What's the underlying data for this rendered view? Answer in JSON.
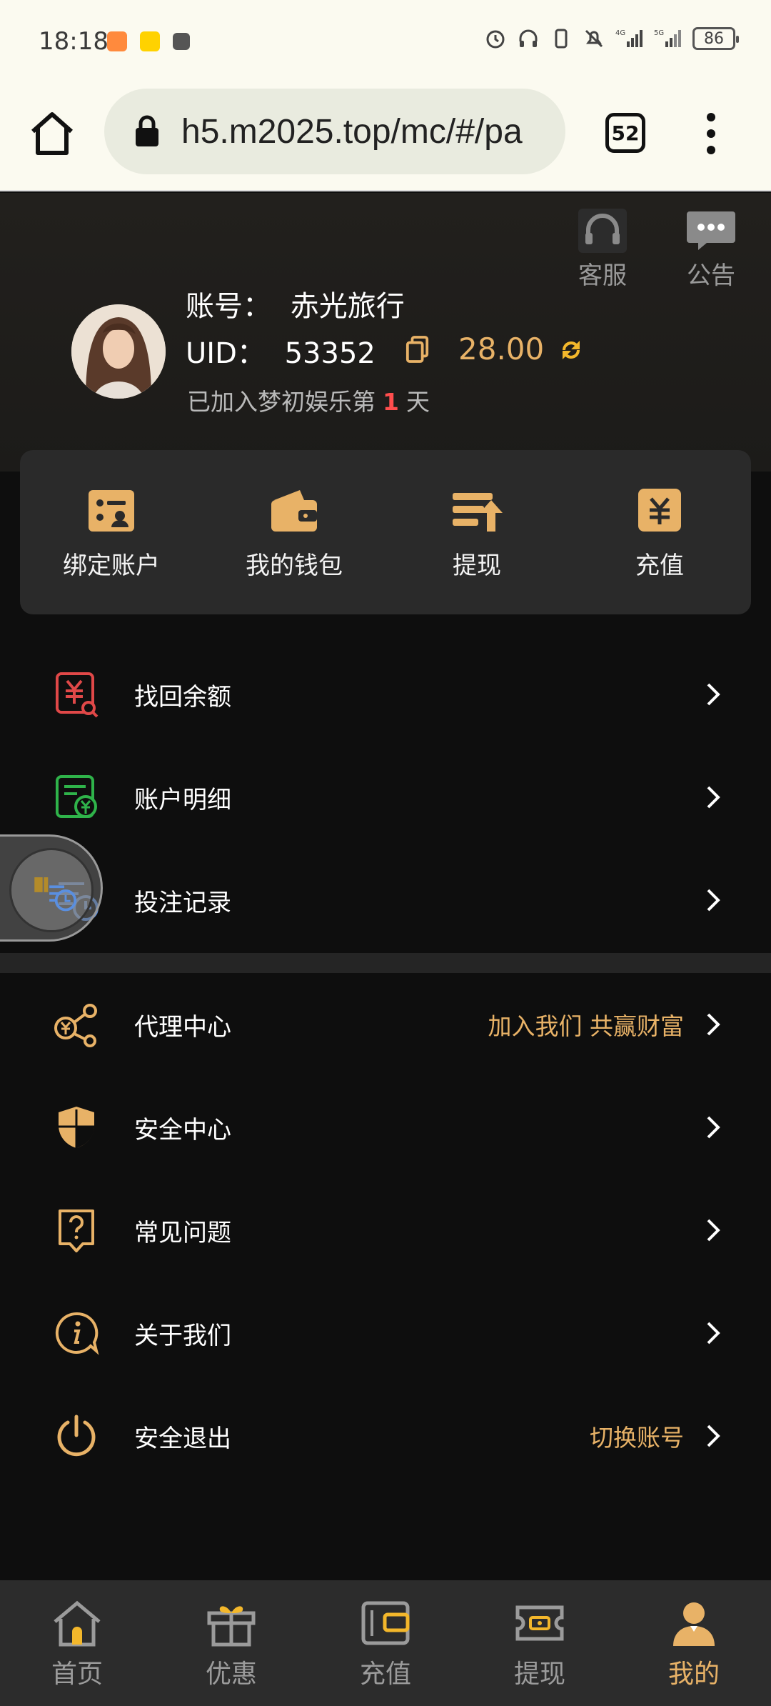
{
  "status_bar": {
    "time": "18:18",
    "battery": "86",
    "icons": [
      "taobao-app-icon",
      "meituan-app-icon",
      "app-icon",
      "alarm-icon",
      "headphones-icon",
      "vibrate-icon",
      "mute-icon",
      "signal-4g-icon",
      "signal-5g-icon",
      "battery-icon"
    ]
  },
  "browser": {
    "url": "h5.m2025.top/mc/#/pa",
    "tab_count": "52"
  },
  "header": {
    "service_label": "客服",
    "notice_label": "公告",
    "account_label": "账号：",
    "account_name": "赤光旅行",
    "uid_label": "UID：",
    "uid": "53352",
    "balance": "28.00",
    "join_prefix": "已加入梦初娱乐第",
    "join_days": "1",
    "join_suffix": "天"
  },
  "quick_actions": [
    {
      "label": "绑定账户",
      "icon": "bind-account-icon"
    },
    {
      "label": "我的钱包",
      "icon": "wallet-icon"
    },
    {
      "label": "提现",
      "icon": "withdraw-icon"
    },
    {
      "label": "充值",
      "icon": "recharge-icon"
    }
  ],
  "menu_group_1": [
    {
      "label": "找回余额",
      "icon": "recover-balance-icon"
    },
    {
      "label": "账户明细",
      "icon": "account-detail-icon"
    },
    {
      "label": "投注记录",
      "icon": "bet-record-icon"
    }
  ],
  "menu_group_2": [
    {
      "label": "代理中心",
      "sub": "加入我们 共赢财富",
      "icon": "agent-center-icon"
    },
    {
      "label": "安全中心",
      "sub": "",
      "icon": "security-shield-icon"
    },
    {
      "label": "常见问题",
      "sub": "",
      "icon": "faq-icon"
    },
    {
      "label": "关于我们",
      "sub": "",
      "icon": "info-icon"
    },
    {
      "label": "安全退出",
      "sub": "切换账号",
      "icon": "power-icon"
    }
  ],
  "bottom_nav": [
    {
      "label": "首页",
      "icon": "home-icon"
    },
    {
      "label": "优惠",
      "icon": "gift-icon"
    },
    {
      "label": "充值",
      "icon": "recharge-wallet-icon"
    },
    {
      "label": "提现",
      "icon": "withdraw-ticket-icon"
    },
    {
      "label": "我的",
      "icon": "profile-icon",
      "active": true
    }
  ],
  "colors": {
    "accent": "#e8b267",
    "background": "#0e0e0e",
    "card": "#2a2a2a",
    "nav": "#2c2c2c"
  }
}
